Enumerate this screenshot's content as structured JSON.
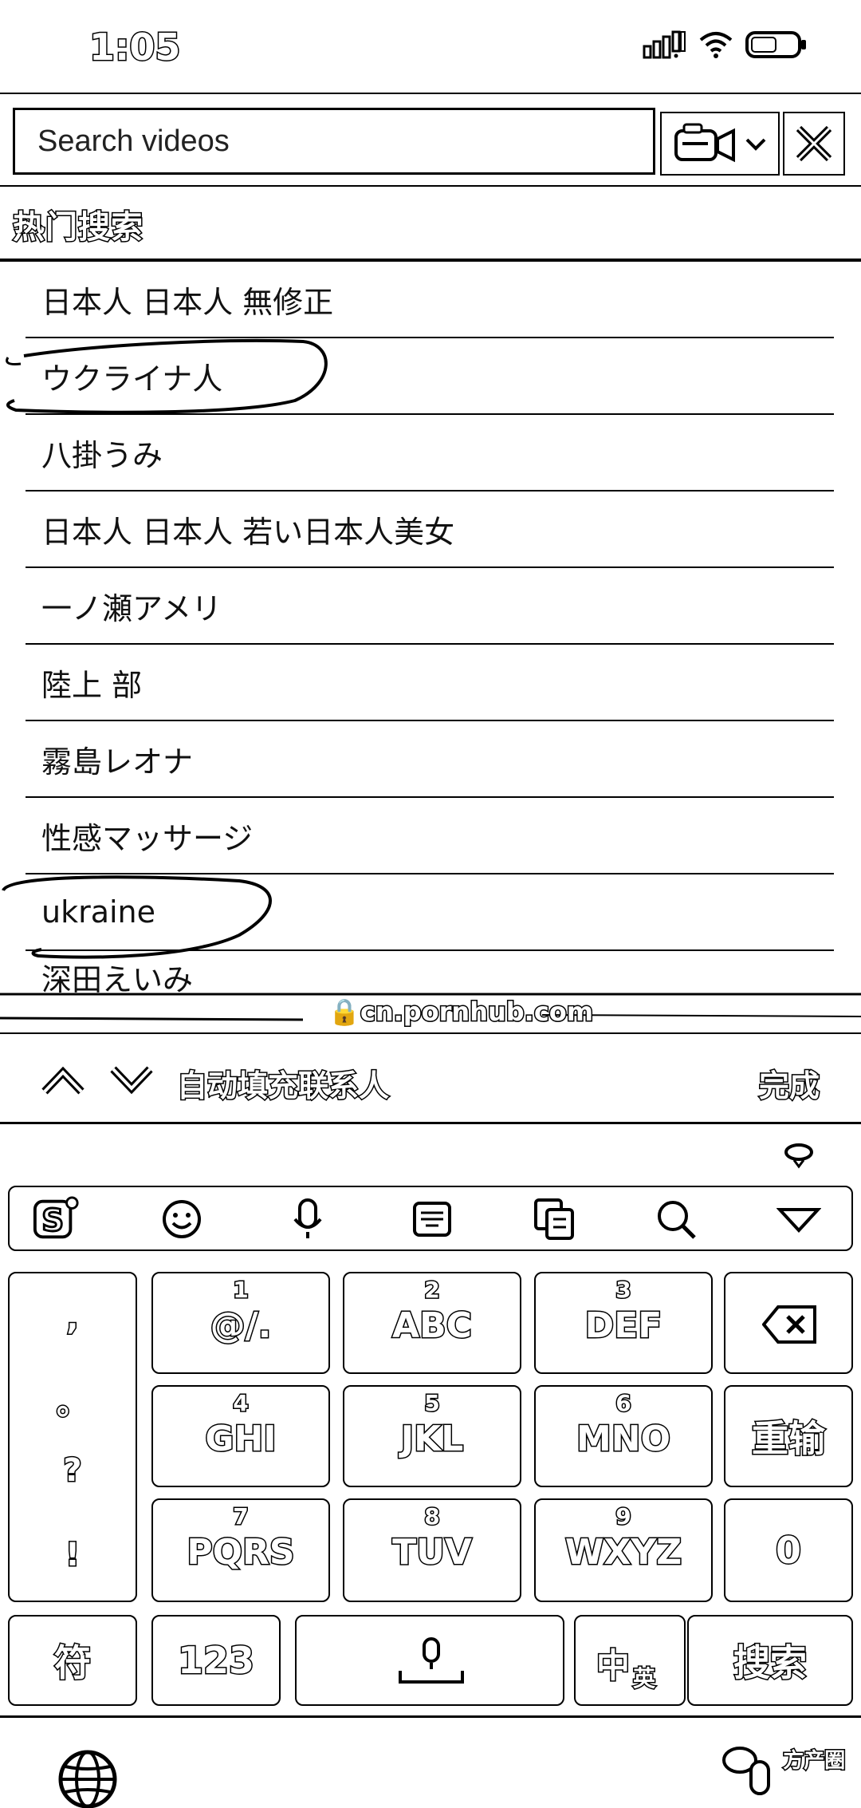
{
  "status_bar": {
    "time": "1:05"
  },
  "search": {
    "placeholder": "Search videos"
  },
  "section_title": "热门搜索",
  "hot_searches": [
    "日本人 日本人 無修正",
    "ウクライナ人",
    "八掛うみ",
    "日本人 日本人 若い日本人美女",
    "一ノ瀬アメリ",
    "陸上 部",
    "霧島レオナ",
    "性感マッサージ",
    "ukraine",
    "深田えいみ"
  ],
  "browser": {
    "url": "cn.pornhub.com"
  },
  "autofill_toolbar": {
    "label": "自动填充联系人",
    "done": "完成"
  },
  "keyboard": {
    "punctuation": [
      ",",
      "。",
      "?",
      "!"
    ],
    "rows": [
      [
        {
          "num": "1",
          "letters": "@/."
        },
        {
          "num": "2",
          "letters": "ABC"
        },
        {
          "num": "3",
          "letters": "DEF"
        }
      ],
      [
        {
          "num": "4",
          "letters": "GHI"
        },
        {
          "num": "5",
          "letters": "JKL"
        },
        {
          "num": "6",
          "letters": "MNO"
        }
      ],
      [
        {
          "num": "7",
          "letters": "PQRS"
        },
        {
          "num": "8",
          "letters": "TUV"
        },
        {
          "num": "9",
          "letters": "WXYZ"
        }
      ]
    ],
    "reenter": "重输",
    "zero": "0",
    "symbols": "符",
    "numbers": "123",
    "lang_main": "中",
    "lang_sub": "英",
    "search_key": "搜索"
  },
  "footer": {
    "mic_label": "方产圈"
  }
}
